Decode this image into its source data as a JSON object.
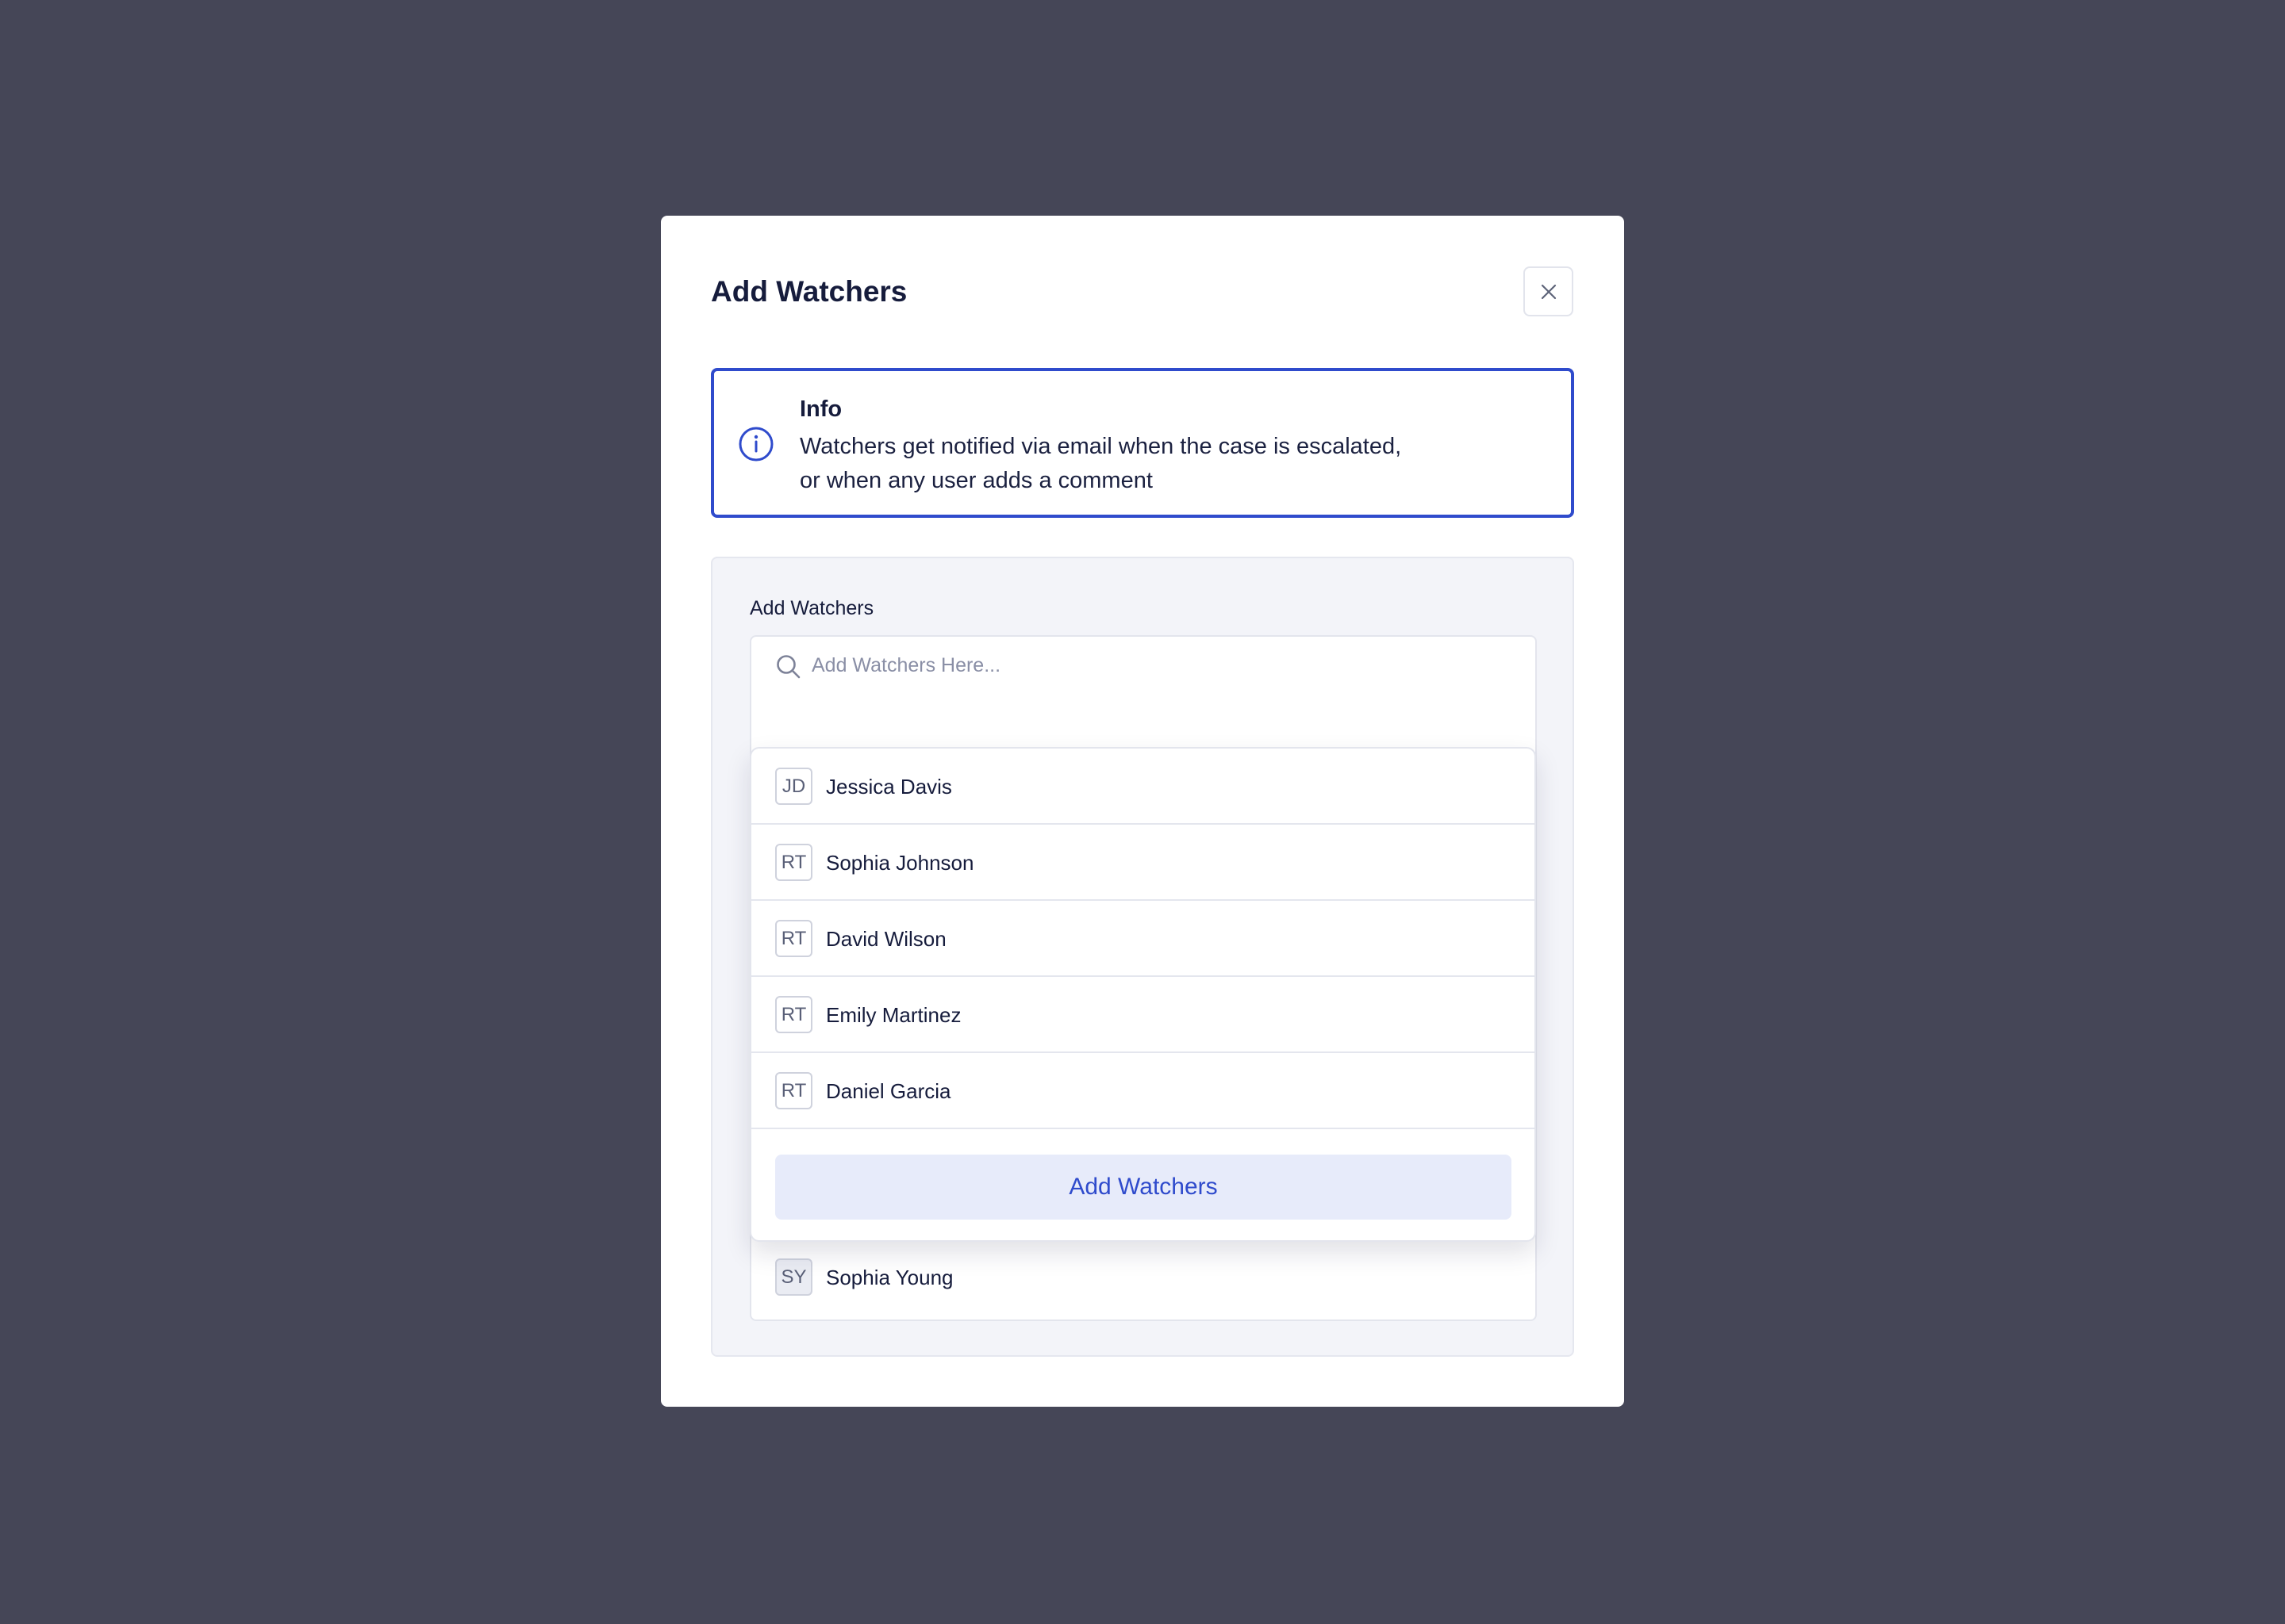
{
  "modal": {
    "title": "Add Watchers",
    "close_icon": "close-icon"
  },
  "info": {
    "icon": "info-icon",
    "title": "Info",
    "line1": "Watchers get notified via email when the case is escalated,",
    "line2": "or when any user adds a comment",
    "accent_color": "#2f4bcc"
  },
  "form": {
    "label": "Add Watchers",
    "search_icon": "search-icon",
    "placeholder": "Add Watchers Here..."
  },
  "dropdown": {
    "options": [
      {
        "initials": "JD",
        "name": "Jessica Davis"
      },
      {
        "initials": "RT",
        "name": "Sophia Johnson"
      },
      {
        "initials": "RT",
        "name": "David Wilson"
      },
      {
        "initials": "RT",
        "name": "Emily Martinez"
      },
      {
        "initials": "RT",
        "name": "Daniel Garcia"
      }
    ],
    "button_label": "Add Watchers"
  },
  "selected": {
    "initials": "SY",
    "name": "Sophia Young"
  },
  "colors": {
    "backdrop": "#454657",
    "accent": "#2f4bcc",
    "button_bg": "#e7ebfa"
  }
}
